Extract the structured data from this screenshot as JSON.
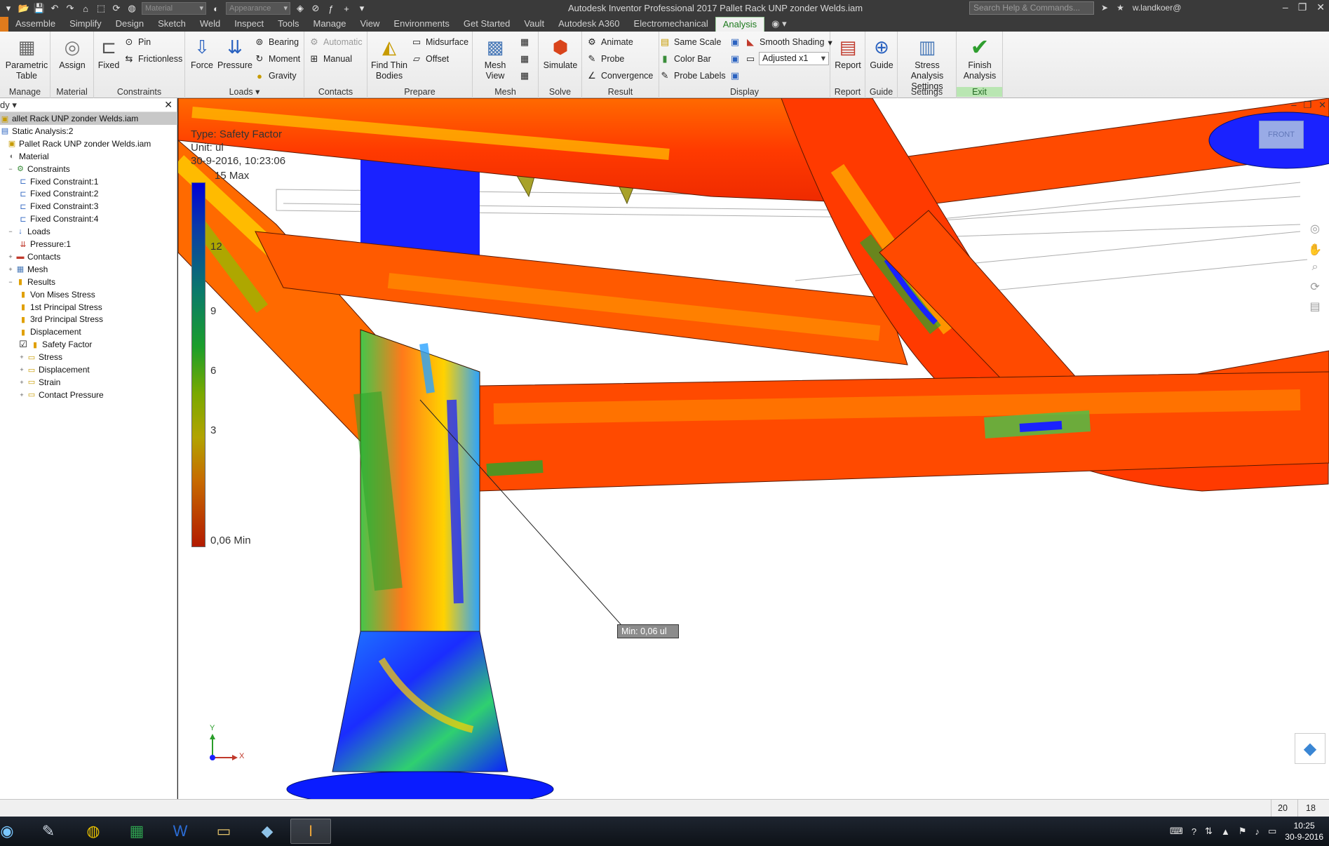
{
  "app": {
    "title": "Autodesk Inventor Professional 2017   Pallet Rack UNP zonder Welds.iam",
    "material_placeholder": "Material",
    "appearance_placeholder": "Appearance",
    "search_placeholder": "Search Help & Commands...",
    "user": "w.landkoer@"
  },
  "tabs": [
    "Assemble",
    "Simplify",
    "Design",
    "Sketch",
    "Weld",
    "Inspect",
    "Tools",
    "Manage",
    "View",
    "Environments",
    "Get Started",
    "Vault",
    "Autodesk A360",
    "Electromechanical",
    "Analysis"
  ],
  "active_tab": "Analysis",
  "ribbon": {
    "manage": {
      "label": "Manage",
      "parametric_table": "Parametric Table"
    },
    "material": {
      "label": "Material",
      "assign": "Assign"
    },
    "constraints": {
      "label": "Constraints",
      "fixed": "Fixed",
      "pin": "Pin",
      "frictionless": "Frictionless"
    },
    "loads": {
      "label": "Loads",
      "force": "Force",
      "pressure": "Pressure",
      "bearing": "Bearing",
      "moment": "Moment",
      "gravity": "Gravity"
    },
    "contacts": {
      "label": "Contacts",
      "automatic": "Automatic",
      "manual": "Manual"
    },
    "prepare": {
      "label": "Prepare",
      "find_thin_bodies": "Find Thin Bodies",
      "midsurface": "Midsurface",
      "offset": "Offset"
    },
    "mesh": {
      "label": "Mesh",
      "mesh_view": "Mesh View"
    },
    "solve": {
      "label": "Solve",
      "simulate": "Simulate"
    },
    "result": {
      "label": "Result",
      "animate": "Animate",
      "probe": "Probe",
      "convergence": "Convergence"
    },
    "display": {
      "label": "Display",
      "same_scale": "Same Scale",
      "color_bar": "Color Bar",
      "probe_labels": "Probe Labels",
      "smooth_shading": "Smooth Shading",
      "adjusted": "Adjusted x1"
    },
    "report": {
      "label": "Report",
      "report": "Report"
    },
    "guide": {
      "label": "Guide",
      "guide": "Guide"
    },
    "settings": {
      "label": "Settings",
      "stress_analysis_settings": "Stress Analysis Settings"
    },
    "exit": {
      "label": "Exit",
      "finish_analysis": "Finish Analysis"
    }
  },
  "browser": {
    "header": "dy",
    "items": [
      {
        "label": "allet Rack UNP zonder Welds.iam",
        "level": 0,
        "icon": "assembly-icon",
        "selected": true
      },
      {
        "label": "Static Analysis:2",
        "level": 0,
        "icon": "analysis-icon"
      },
      {
        "label": "Pallet Rack UNP zonder Welds.iam",
        "level": 1,
        "icon": "assembly-icon"
      },
      {
        "label": "Material",
        "level": 1,
        "icon": "material-icon"
      },
      {
        "label": "Constraints",
        "level": 1,
        "icon": "constraints-icon"
      },
      {
        "label": "Fixed Constraint:1",
        "level": 2,
        "icon": "fixed-constraint-icon"
      },
      {
        "label": "Fixed Constraint:2",
        "level": 2,
        "icon": "fixed-constraint-icon"
      },
      {
        "label": "Fixed Constraint:3",
        "level": 2,
        "icon": "fixed-constraint-icon"
      },
      {
        "label": "Fixed Constraint:4",
        "level": 2,
        "icon": "fixed-constraint-icon"
      },
      {
        "label": "Loads",
        "level": 1,
        "icon": "loads-icon"
      },
      {
        "label": "Pressure:1",
        "level": 2,
        "icon": "pressure-icon"
      },
      {
        "label": "Contacts",
        "level": 1,
        "icon": "contacts-icon"
      },
      {
        "label": "Mesh",
        "level": 1,
        "icon": "mesh-icon"
      },
      {
        "label": "Results",
        "level": 1,
        "icon": "results-icon"
      },
      {
        "label": "Von Mises Stress",
        "level": 2,
        "icon": "result-icon"
      },
      {
        "label": "1st Principal Stress",
        "level": 2,
        "icon": "result-icon"
      },
      {
        "label": "3rd Principal Stress",
        "level": 2,
        "icon": "result-icon"
      },
      {
        "label": "Displacement",
        "level": 2,
        "icon": "result-icon"
      },
      {
        "label": "Safety Factor",
        "level": 2,
        "icon": "result-icon",
        "checked": true
      },
      {
        "label": "Stress",
        "level": 2,
        "icon": "folder-icon"
      },
      {
        "label": "Displacement",
        "level": 2,
        "icon": "folder-icon"
      },
      {
        "label": "Strain",
        "level": 2,
        "icon": "folder-icon"
      },
      {
        "label": "Contact Pressure",
        "level": 2,
        "icon": "folder-icon"
      }
    ]
  },
  "viewport": {
    "type_label": "Type: Safety Factor",
    "unit_label": "Unit: ul",
    "timestamp": "30-9-2016, 10:23:06",
    "legend": [
      "15 Max",
      "12",
      "9",
      "6",
      "3",
      "0,06 Min"
    ],
    "min_callout": "Min: 0,06 ul",
    "viewcube_label": "FRONT",
    "axis_x": "X",
    "axis_y": "Y"
  },
  "status": {
    "count1": "20",
    "count2": "18"
  },
  "taskbar": {
    "time": "10:25",
    "date": "30-9-2016"
  }
}
